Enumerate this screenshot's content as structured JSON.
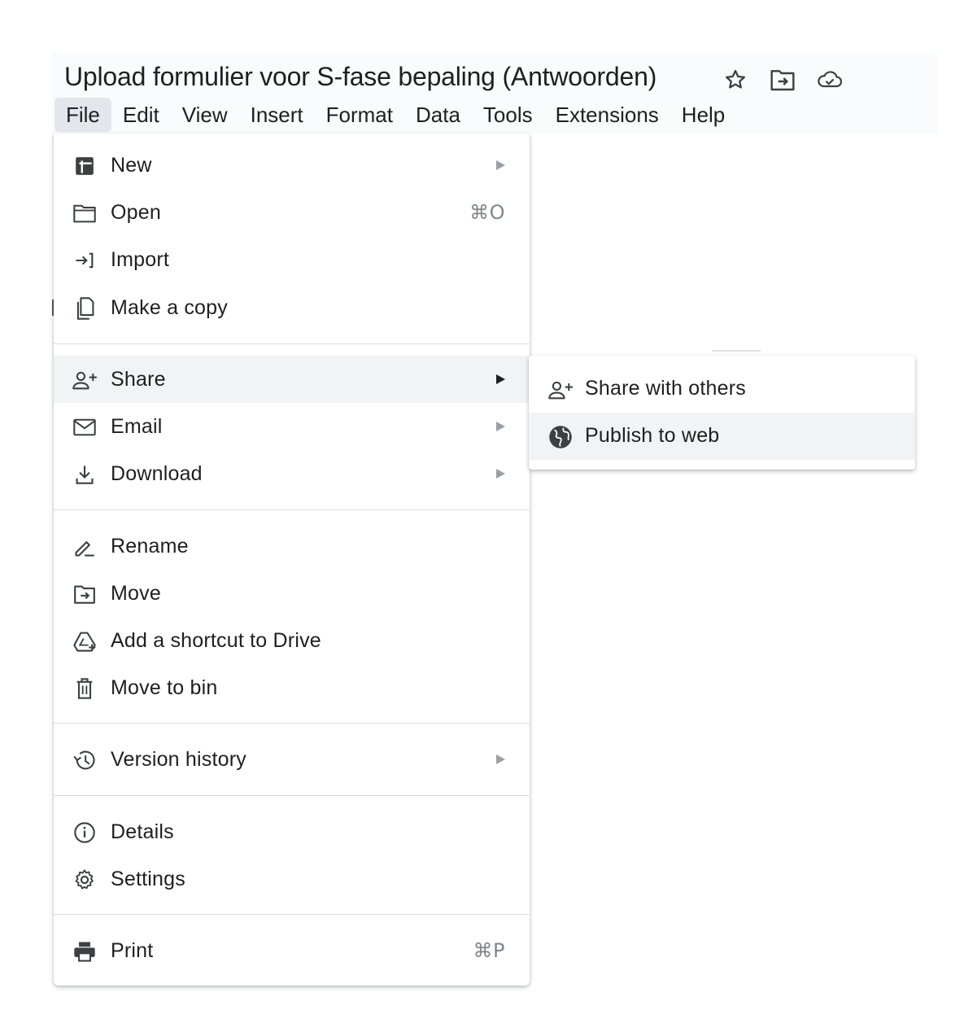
{
  "document": {
    "title": "Upload formulier voor S-fase bepaling (Antwoorden)",
    "title_icons": [
      "star-icon",
      "move-folder-icon",
      "cloud-saved-icon"
    ]
  },
  "menubar": {
    "items": [
      "File",
      "Edit",
      "View",
      "Insert",
      "Format",
      "Data",
      "Tools",
      "Extensions",
      "Help"
    ],
    "active": "File"
  },
  "file_menu": {
    "groups": [
      [
        {
          "label": "New",
          "icon": "new-sheet-icon",
          "submenu": true
        },
        {
          "label": "Open",
          "icon": "folder-icon",
          "shortcut": "⌘O"
        },
        {
          "label": "Import",
          "icon": "import-icon"
        },
        {
          "label": "Make a copy",
          "icon": "copy-icon"
        }
      ],
      [
        {
          "label": "Share",
          "icon": "person-add-icon",
          "submenu": true,
          "highlighted": true
        },
        {
          "label": "Email",
          "icon": "mail-icon",
          "submenu": true
        },
        {
          "label": "Download",
          "icon": "download-icon",
          "submenu": true
        }
      ],
      [
        {
          "label": "Rename",
          "icon": "rename-icon"
        },
        {
          "label": "Move",
          "icon": "move-folder-icon"
        },
        {
          "label": "Add a shortcut to Drive",
          "icon": "drive-shortcut-icon"
        },
        {
          "label": "Move to bin",
          "icon": "trash-icon"
        }
      ],
      [
        {
          "label": "Version history",
          "icon": "history-icon",
          "submenu": true
        }
      ],
      [
        {
          "label": "Details",
          "icon": "info-icon"
        },
        {
          "label": "Settings",
          "icon": "gear-icon"
        }
      ],
      [
        {
          "label": "Print",
          "icon": "print-icon",
          "shortcut": "⌘P"
        }
      ]
    ]
  },
  "share_submenu": {
    "items": [
      {
        "label": "Share with others",
        "icon": "person-add-icon"
      },
      {
        "label": "Publish to web",
        "icon": "globe-icon",
        "highlighted": true
      }
    ]
  },
  "colors": {
    "menu_highlight": "#f1f3f4",
    "header_bg": "#f9fbfd",
    "active_menu_bg": "#e3e7ec",
    "text": "#1f1f1f",
    "shortcut_text": "#80868b"
  }
}
